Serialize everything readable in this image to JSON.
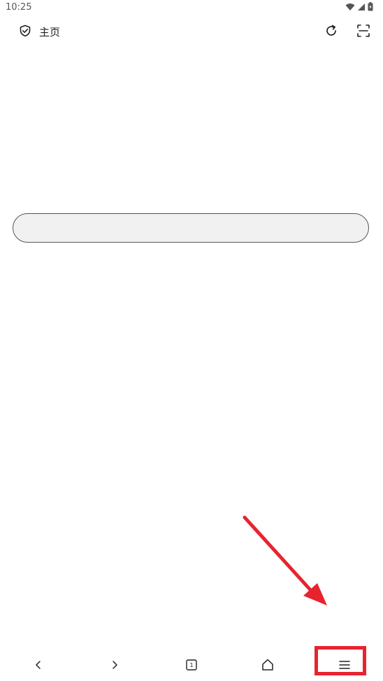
{
  "status_bar": {
    "time": "10:25",
    "icons": [
      "wifi-icon",
      "signal-icon",
      "battery-icon"
    ]
  },
  "top_bar": {
    "shield_icon": "shield-check-icon",
    "title": "主页",
    "refresh_icon": "refresh-icon",
    "scan_icon": "scan-icon"
  },
  "search": {
    "placeholder": ""
  },
  "bottom_nav": {
    "back_icon": "chevron-left-icon",
    "forward_icon": "chevron-right-icon",
    "tabs_icon": "tabs-icon",
    "tab_count": "1",
    "home_icon": "home-icon",
    "menu_icon": "menu-icon"
  },
  "annotation": {
    "arrow_color": "#e8232f",
    "box_color": "#e8232f"
  }
}
